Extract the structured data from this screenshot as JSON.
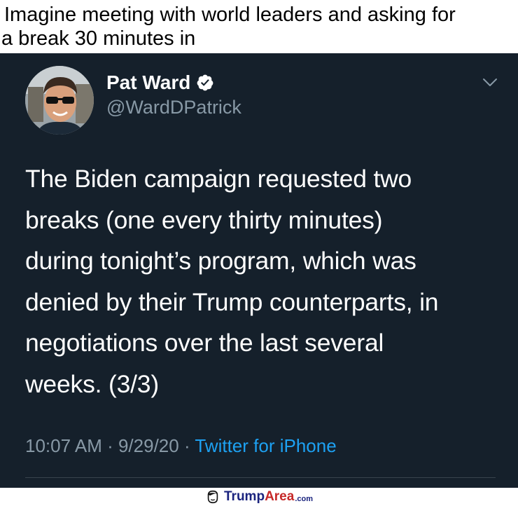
{
  "caption": {
    "line1": "Imagine meeting with world leaders and asking for",
    "line2": "a break 30 minutes in"
  },
  "tweet": {
    "author_name": "Pat Ward",
    "author_handle": "@WardDPatrick",
    "verified_icon": "verified-badge-icon",
    "menu_icon": "chevron-down-icon",
    "text": "The Biden campaign requested two\nbreaks (one every thirty minutes)\nduring tonight’s program, which was\ndenied by their Trump counterparts, in\nnegotiations over the last several\nweeks. (3/3)",
    "time": "10:07 AM",
    "separator": " · ",
    "date": "9/29/20",
    "source": "Twitter for iPhone",
    "colors": {
      "background": "#15202b",
      "secondary_text": "#8899a6",
      "link": "#1da1f2"
    }
  },
  "footer": {
    "logo_icon": "trump-head-icon",
    "logo_part1": "Trump",
    "logo_part2": "Area",
    "logo_part3": ".com"
  }
}
